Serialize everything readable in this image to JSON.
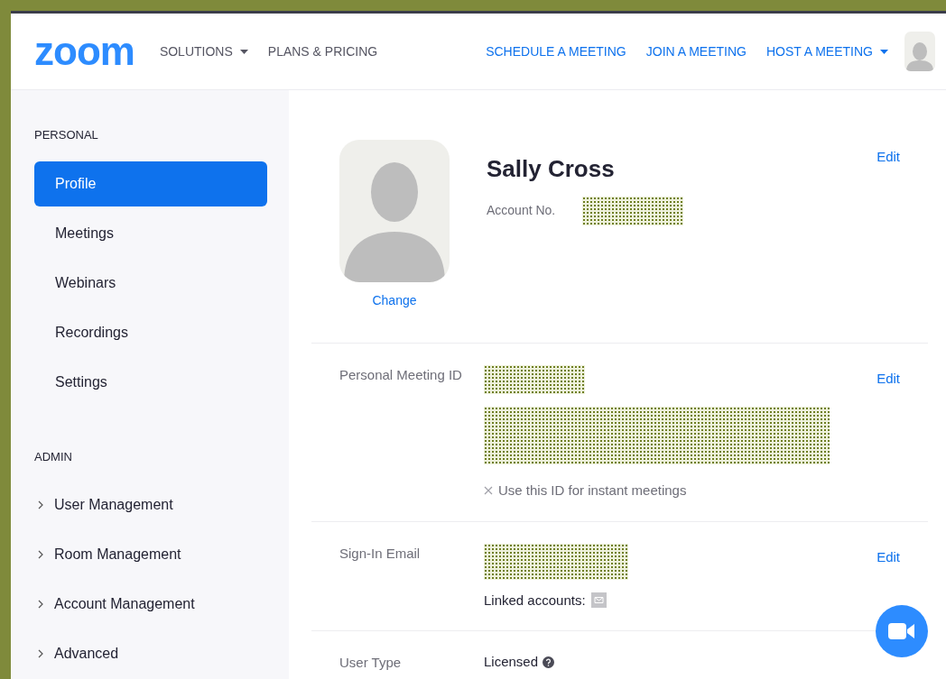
{
  "header": {
    "logo": "zoom",
    "nav_left": [
      {
        "label": "SOLUTIONS",
        "dropdown": true
      },
      {
        "label": "PLANS & PRICING",
        "dropdown": false
      }
    ],
    "nav_right": [
      {
        "label": "SCHEDULE A MEETING",
        "dropdown": false
      },
      {
        "label": "JOIN A MEETING",
        "dropdown": false
      },
      {
        "label": "HOST A MEETING",
        "dropdown": true
      }
    ]
  },
  "sidebar": {
    "sections": [
      {
        "title": "PERSONAL",
        "items": [
          {
            "label": "Profile",
            "selected": true,
            "expandable": false
          },
          {
            "label": "Meetings",
            "selected": false,
            "expandable": false
          },
          {
            "label": "Webinars",
            "selected": false,
            "expandable": false
          },
          {
            "label": "Recordings",
            "selected": false,
            "expandable": false
          },
          {
            "label": "Settings",
            "selected": false,
            "expandable": false
          }
        ]
      },
      {
        "title": "ADMIN",
        "items": [
          {
            "label": "User Management",
            "selected": false,
            "expandable": true
          },
          {
            "label": "Room Management",
            "selected": false,
            "expandable": true
          },
          {
            "label": "Account Management",
            "selected": false,
            "expandable": true
          },
          {
            "label": "Advanced",
            "selected": false,
            "expandable": true
          }
        ]
      }
    ]
  },
  "profile": {
    "name": "Sally Cross",
    "change_link": "Change",
    "account_label": "Account No.",
    "account_value": {
      "kind": "redacted"
    },
    "edit": "Edit"
  },
  "rows": [
    {
      "label": "Personal Meeting ID",
      "edit": "Edit",
      "values": [
        {
          "kind": "redacted"
        },
        {
          "kind": "redacted_wide"
        },
        {
          "kind": "option",
          "text": "Use this ID for instant meetings",
          "checked": false
        }
      ]
    },
    {
      "label": "Sign-In Email",
      "edit": "Edit",
      "values": [
        {
          "kind": "redacted_medium"
        },
        {
          "kind": "linked",
          "text": "Linked accounts:"
        }
      ]
    },
    {
      "label": "User Type",
      "values": [
        {
          "kind": "info",
          "text": "Licensed"
        }
      ]
    }
  ]
}
